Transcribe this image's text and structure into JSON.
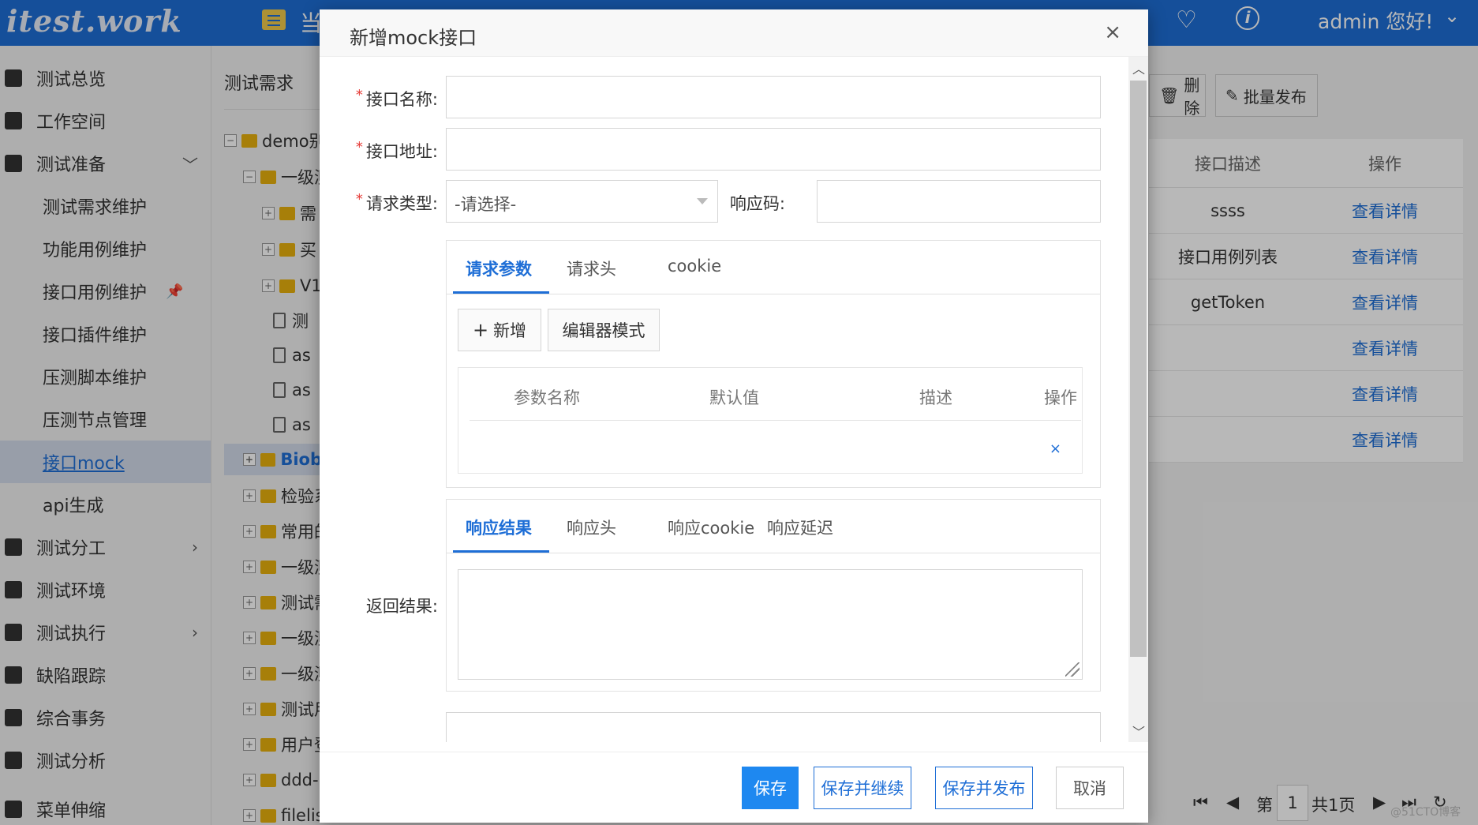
{
  "app": {
    "logo": "itest.work",
    "header_crumb": "当",
    "user": "admin 您好!"
  },
  "sidebar": {
    "items": [
      {
        "label": "测试总览"
      },
      {
        "label": "工作空间"
      },
      {
        "label": "测试准备"
      },
      {
        "label": "测试需求维护"
      },
      {
        "label": "功能用例维护"
      },
      {
        "label": "接口用例维护"
      },
      {
        "label": "接口插件维护"
      },
      {
        "label": "压测脚本维护"
      },
      {
        "label": "压测节点管理"
      },
      {
        "label": "接口mock"
      },
      {
        "label": "api生成"
      },
      {
        "label": "测试分工"
      },
      {
        "label": "测试环境"
      },
      {
        "label": "测试执行"
      },
      {
        "label": "缺陷跟踪"
      },
      {
        "label": "综合事务"
      },
      {
        "label": "测试分析"
      },
      {
        "label": "菜单伸缩"
      }
    ]
  },
  "tree": {
    "title": "测试需求",
    "nodes": [
      {
        "label": "demo别"
      },
      {
        "label": "一级测"
      },
      {
        "label": "需"
      },
      {
        "label": "买"
      },
      {
        "label": "V1"
      },
      {
        "label": "测"
      },
      {
        "label": "as"
      },
      {
        "label": "as"
      },
      {
        "label": "as"
      },
      {
        "label": "Biob"
      },
      {
        "label": "检验系"
      },
      {
        "label": "常用的"
      },
      {
        "label": "一级测"
      },
      {
        "label": "测试需"
      },
      {
        "label": "一级测"
      },
      {
        "label": "一级测"
      },
      {
        "label": "测试用"
      },
      {
        "label": "用户登"
      },
      {
        "label": "ddd-"
      },
      {
        "label": "filelis"
      }
    ]
  },
  "content": {
    "delete_label": "删除",
    "batch_publish_label": "批量发布",
    "table": {
      "headers": [
        "接口描述",
        "操作"
      ],
      "rows": [
        {
          "desc": "ssss",
          "action": "查看详情"
        },
        {
          "desc": "接口用例列表",
          "action": "查看详情"
        },
        {
          "desc": "getToken",
          "action": "查看详情"
        },
        {
          "desc": "",
          "action": "查看详情"
        },
        {
          "desc": "",
          "action": "查看详情"
        },
        {
          "desc": "",
          "action": "查看详情"
        }
      ]
    },
    "pager": {
      "page_prefix": "第",
      "page": "1",
      "total": "共1页"
    },
    "watermark": "@51CTO博客"
  },
  "modal": {
    "title": "新增mock接口",
    "close": "×",
    "fields": {
      "name_label": "接口名称:",
      "url_label": "接口地址:",
      "method_label": "请求类型:",
      "method_value": "-请选择-",
      "code_label": "响应码:",
      "result_label": "返回结果:"
    },
    "request_tabs": [
      "请求参数",
      "请求头",
      "cookie"
    ],
    "add_label": "新增",
    "editor_mode_label": "编辑器模式",
    "param_headers": [
      "参数名称",
      "默认值",
      "描述",
      "操作"
    ],
    "param_remove": "×",
    "response_tabs": [
      "响应结果",
      "响应头",
      "响应cookie",
      "响应延迟"
    ],
    "buttons": {
      "save": "保存",
      "save_continue": "保存并继续",
      "save_publish": "保存并发布",
      "cancel": "取消"
    }
  },
  "colors": {
    "primary": "#1e6ed6",
    "button_primary": "#1e88f0",
    "required": "#e53935",
    "folder": "#e8b10d"
  }
}
